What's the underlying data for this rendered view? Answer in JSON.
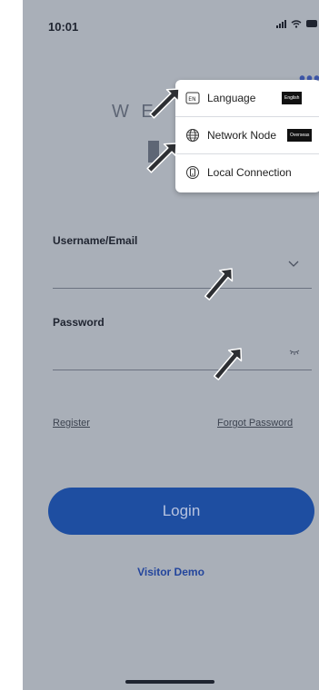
{
  "status_bar": {
    "time": "10:01"
  },
  "header": {
    "more_label": "•••",
    "welcome_text": "W E"
  },
  "menu": {
    "items": [
      {
        "label": "Language",
        "tag": "English",
        "icon": "language-icon"
      },
      {
        "label": "Network Node",
        "tag": "Overseas",
        "icon": "globe-icon"
      },
      {
        "label": "Local Connection",
        "tag": "",
        "icon": "device-icon"
      }
    ]
  },
  "form": {
    "username_label": "Username/Email",
    "password_label": "Password"
  },
  "links": {
    "register": "Register",
    "forgot": "Forgot Password"
  },
  "login_button": {
    "label": "Login"
  },
  "visitor_demo": {
    "label": "Visitor Demo"
  },
  "colors": {
    "overlay_bg": "#a9afb8",
    "primary": "#1e4ea1",
    "link_blue": "#23459c"
  }
}
